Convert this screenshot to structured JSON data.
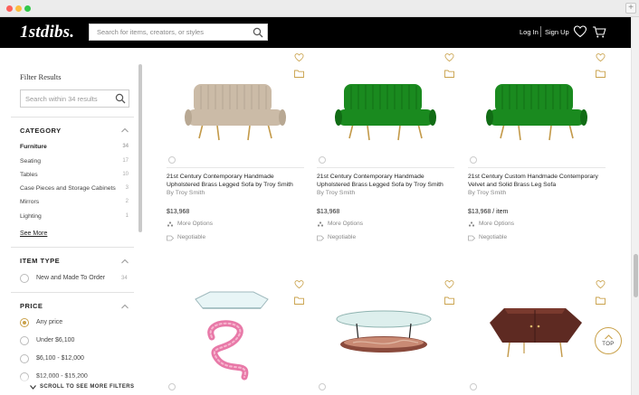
{
  "header": {
    "logo": "1stdibs.",
    "search_placeholder": "Search for items, creators, or styles",
    "login": "Log In",
    "signup": "Sign Up"
  },
  "sidebar": {
    "title": "Filter Results",
    "search_placeholder": "Search within 34 results",
    "category": {
      "title": "CATEGORY",
      "items": [
        {
          "label": "Furniture",
          "count": "34"
        },
        {
          "label": "Seating",
          "count": "17"
        },
        {
          "label": "Tables",
          "count": "10"
        },
        {
          "label": "Case Pieces and Storage Cabinets",
          "count": "3"
        },
        {
          "label": "Mirrors",
          "count": "2"
        },
        {
          "label": "Lighting",
          "count": "1"
        }
      ],
      "see_more": "See More"
    },
    "item_type": {
      "title": "ITEM TYPE",
      "options": [
        {
          "label": "New and Made To Order",
          "count": "34"
        }
      ]
    },
    "price": {
      "title": "PRICE",
      "options": [
        "Any price",
        "Under $6,100",
        "$6,100 - $12,000",
        "$12,000 - $15,200"
      ]
    },
    "scroll_hint": "SCROLL TO SEE MORE FILTERS"
  },
  "products": [
    {
      "title_line1": "21st Century Contemporary Handmade",
      "title_line2": "Upholstered Brass Legged Sofa by Troy Smith",
      "maker": "By Troy Smith",
      "price": "$13,968",
      "more_options": "More Options",
      "negotiable": "Negotiable",
      "color": "#cbbba7"
    },
    {
      "title_line1": "21st Century Contemporary Handmade",
      "title_line2": "Upholstered Brass Legged Sofa by Troy Smith",
      "maker": "By Troy Smith",
      "price": "$13,968",
      "more_options": "More Options",
      "negotiable": "Negotiable",
      "color": "#1a8a1f"
    },
    {
      "title_line1": "21st Century Custom Handmade Contemporary",
      "title_line2": "Velvet and Solid Brass Leg Sofa",
      "maker": "By Troy Smith",
      "price": "$13,968 / item",
      "more_options": "More Options",
      "negotiable": "Negotiable",
      "color": "#1a8a1f"
    }
  ],
  "top_button": "TOP",
  "colors": {
    "accent": "#c9a14a",
    "header_bg": "#000000"
  }
}
